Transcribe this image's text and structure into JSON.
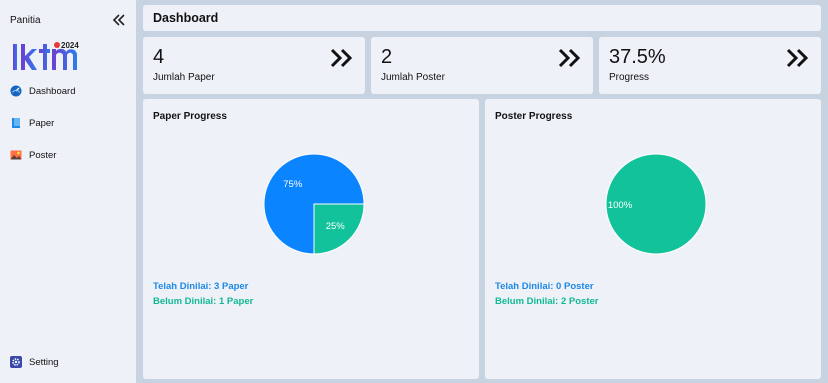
{
  "sidebar": {
    "title": "Panitia",
    "logo_text": "iktm",
    "logo_year": "2024",
    "items": [
      {
        "label": "Dashboard",
        "icon": "dashboard-icon"
      },
      {
        "label": "Paper",
        "icon": "paper-icon"
      },
      {
        "label": "Poster",
        "icon": "poster-icon"
      }
    ],
    "footer_item": {
      "label": "Setting",
      "icon": "gear-icon"
    }
  },
  "header": {
    "title": "Dashboard"
  },
  "stats": [
    {
      "value": "4",
      "label": "Jumlah Paper"
    },
    {
      "value": "2",
      "label": "Jumlah Poster"
    },
    {
      "value": "37.5%",
      "label": "Progress"
    }
  ],
  "colors": {
    "assessed": "#0a84ff",
    "pending": "#12c29a"
  },
  "paper_chart": {
    "title": "Paper Progress",
    "legend_assessed": "Telah Dinilai: 3 Paper",
    "legend_pending": "Belum Dinilai: 1 Paper",
    "chart_data": {
      "type": "pie",
      "categories": [
        "Telah Dinilai",
        "Belum Dinilai"
      ],
      "values": [
        3,
        1
      ],
      "labels": [
        "75%",
        "25%"
      ]
    }
  },
  "poster_chart": {
    "title": "Poster Progress",
    "legend_assessed": "Telah Dinilai: 0 Poster",
    "legend_pending": "Belum Dinilai: 2 Poster",
    "chart_data": {
      "type": "pie",
      "categories": [
        "Telah Dinilai",
        "Belum Dinilai"
      ],
      "values": [
        0,
        2
      ],
      "labels": [
        "0%",
        "100%"
      ]
    }
  }
}
